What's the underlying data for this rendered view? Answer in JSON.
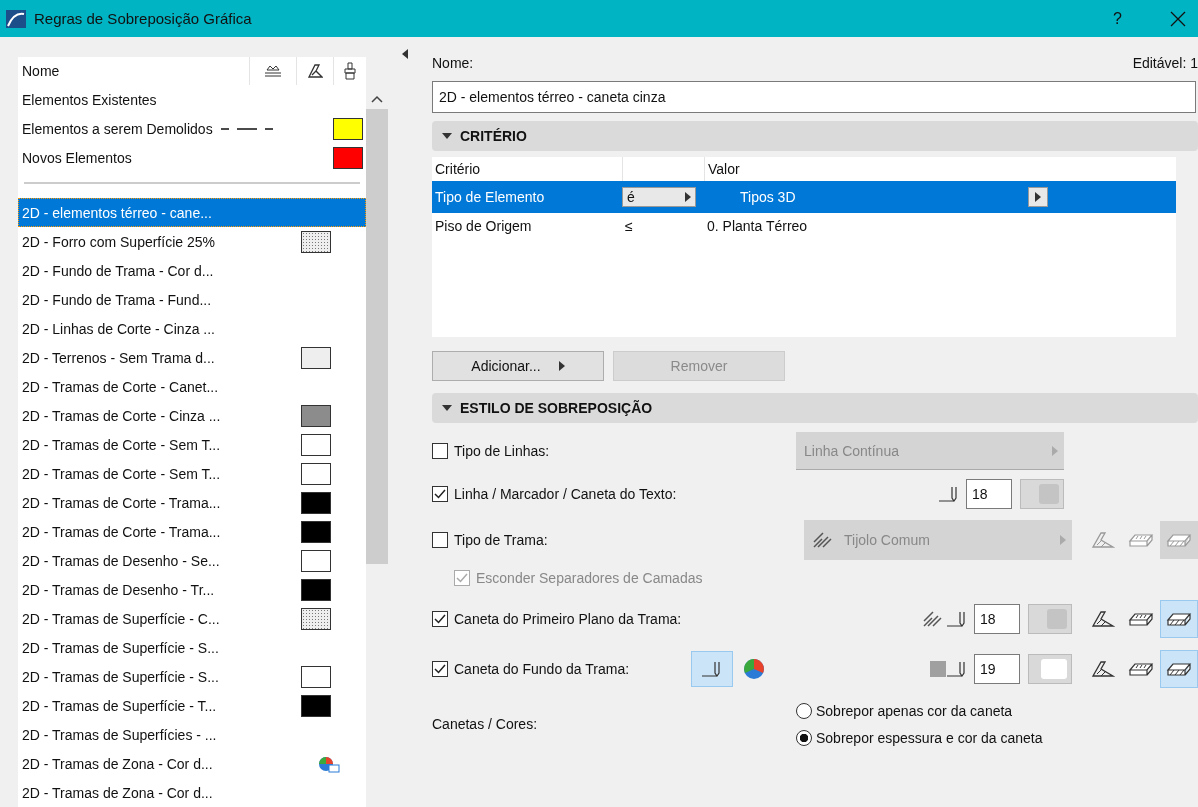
{
  "window": {
    "title": "Regras de Sobreposição Gráfica",
    "help": "?"
  },
  "left": {
    "column": "Nome",
    "fixed_rows": [
      {
        "label": "Elementos Existentes",
        "dashes": false
      },
      {
        "label": "Elementos a serem Demolidos",
        "dashes": true,
        "color": "#ffff00"
      },
      {
        "label": "Novos Elementos",
        "dashes": false,
        "color": "#ff0000"
      }
    ],
    "rules": [
      {
        "label": "2D - elementos térreo - cane...",
        "selected": true
      },
      {
        "label": "2D - Forro com Superfície 25%",
        "selected": false,
        "kind": "dotted"
      },
      {
        "label": "2D - Fundo de Trama - Cor d...",
        "selected": false
      },
      {
        "label": "2D - Fundo de Trama - Fund...",
        "selected": false
      },
      {
        "label": "2D - Linhas de Corte - Cinza ...",
        "selected": false
      },
      {
        "label": "2D - Terrenos - Sem Trama d...",
        "selected": false,
        "kind": "solid",
        "color": "#eeeeee"
      },
      {
        "label": "2D - Tramas de Corte - Canet...",
        "selected": false
      },
      {
        "label": "2D - Tramas de Corte - Cinza ...",
        "selected": false,
        "kind": "solid",
        "color": "#8c8c8c"
      },
      {
        "label": "2D - Tramas de Corte - Sem T...",
        "selected": false,
        "kind": "solid",
        "color": "#ffffff"
      },
      {
        "label": "2D - Tramas de Corte - Sem T...",
        "selected": false,
        "kind": "solid",
        "color": "#ffffff"
      },
      {
        "label": "2D - Tramas de Corte - Trama...",
        "selected": false,
        "kind": "solid",
        "color": "#000000"
      },
      {
        "label": "2D - Tramas de Corte - Trama...",
        "selected": false,
        "kind": "solid",
        "color": "#000000"
      },
      {
        "label": "2D - Tramas de Desenho - Se...",
        "selected": false,
        "kind": "solid",
        "color": "#ffffff"
      },
      {
        "label": "2D - Tramas de Desenho - Tr...",
        "selected": false,
        "kind": "solid",
        "color": "#000000"
      },
      {
        "label": "2D - Tramas de Superfície - C...",
        "selected": false,
        "kind": "dotted"
      },
      {
        "label": "2D - Tramas de Superfície - S...",
        "selected": false
      },
      {
        "label": "2D - Tramas de Superfície - S...",
        "selected": false,
        "kind": "solid",
        "color": "#ffffff"
      },
      {
        "label": "2D - Tramas de Superfície - T...",
        "selected": false,
        "kind": "solid",
        "color": "#000000"
      },
      {
        "label": "2D - Tramas de Superfícies - ...",
        "selected": false
      },
      {
        "label": "2D - Tramas de Zona - Cor d...",
        "selected": false,
        "kind": "zone"
      },
      {
        "label": "2D - Tramas de Zona - Cor d...",
        "selected": false
      }
    ]
  },
  "name_label": "Nome:",
  "editable": "Editável: 1",
  "name_value": "2D - elementos térreo - caneta cinza",
  "criteria": {
    "title": "CRITÉRIO",
    "expanded": true,
    "columns": [
      "Critério",
      "Valor"
    ],
    "rows": [
      {
        "criterion": "Tipo de Elemento",
        "operator": "é",
        "value": "Tipos 3D",
        "selected": true
      },
      {
        "criterion": "Piso de Origem",
        "operator": "≤",
        "value": "0. Planta Térreo",
        "selected": false
      }
    ],
    "buttons": [
      {
        "label": "Adicionar...",
        "disabled": false
      },
      {
        "label": "Remover",
        "disabled": true
      }
    ]
  },
  "style": {
    "title": "ESTILO DE SOBREPOSIÇÃO",
    "expanded": true,
    "rows": [
      {
        "kind": "line",
        "label": "Tipo de Linhas:",
        "checked": false,
        "value": "Linha Contínua"
      },
      {
        "kind": "pen",
        "label": "Linha / Marcador / Caneta do Texto:",
        "checked": true,
        "pen": "18"
      },
      {
        "kind": "fill",
        "label": "Tipo de Trama:",
        "checked": false,
        "value": "Tijolo Comum"
      },
      {
        "kind": "sub",
        "label": "Esconder Separadores de Camadas",
        "checked": true,
        "disabled": true
      },
      {
        "kind": "fgpen",
        "label": "Caneta do Primeiro Plano da Trama:",
        "checked": true,
        "pen": "18"
      },
      {
        "kind": "bgpen",
        "label": "Caneta do Fundo da Trama:",
        "checked": true,
        "pen": "19"
      }
    ],
    "pens_label": "Canetas / Cores:",
    "radios": [
      {
        "label": "Sobrepor apenas cor da caneta",
        "selected": false
      },
      {
        "label": "Sobrepor espessura e cor da caneta",
        "selected": true
      }
    ]
  }
}
